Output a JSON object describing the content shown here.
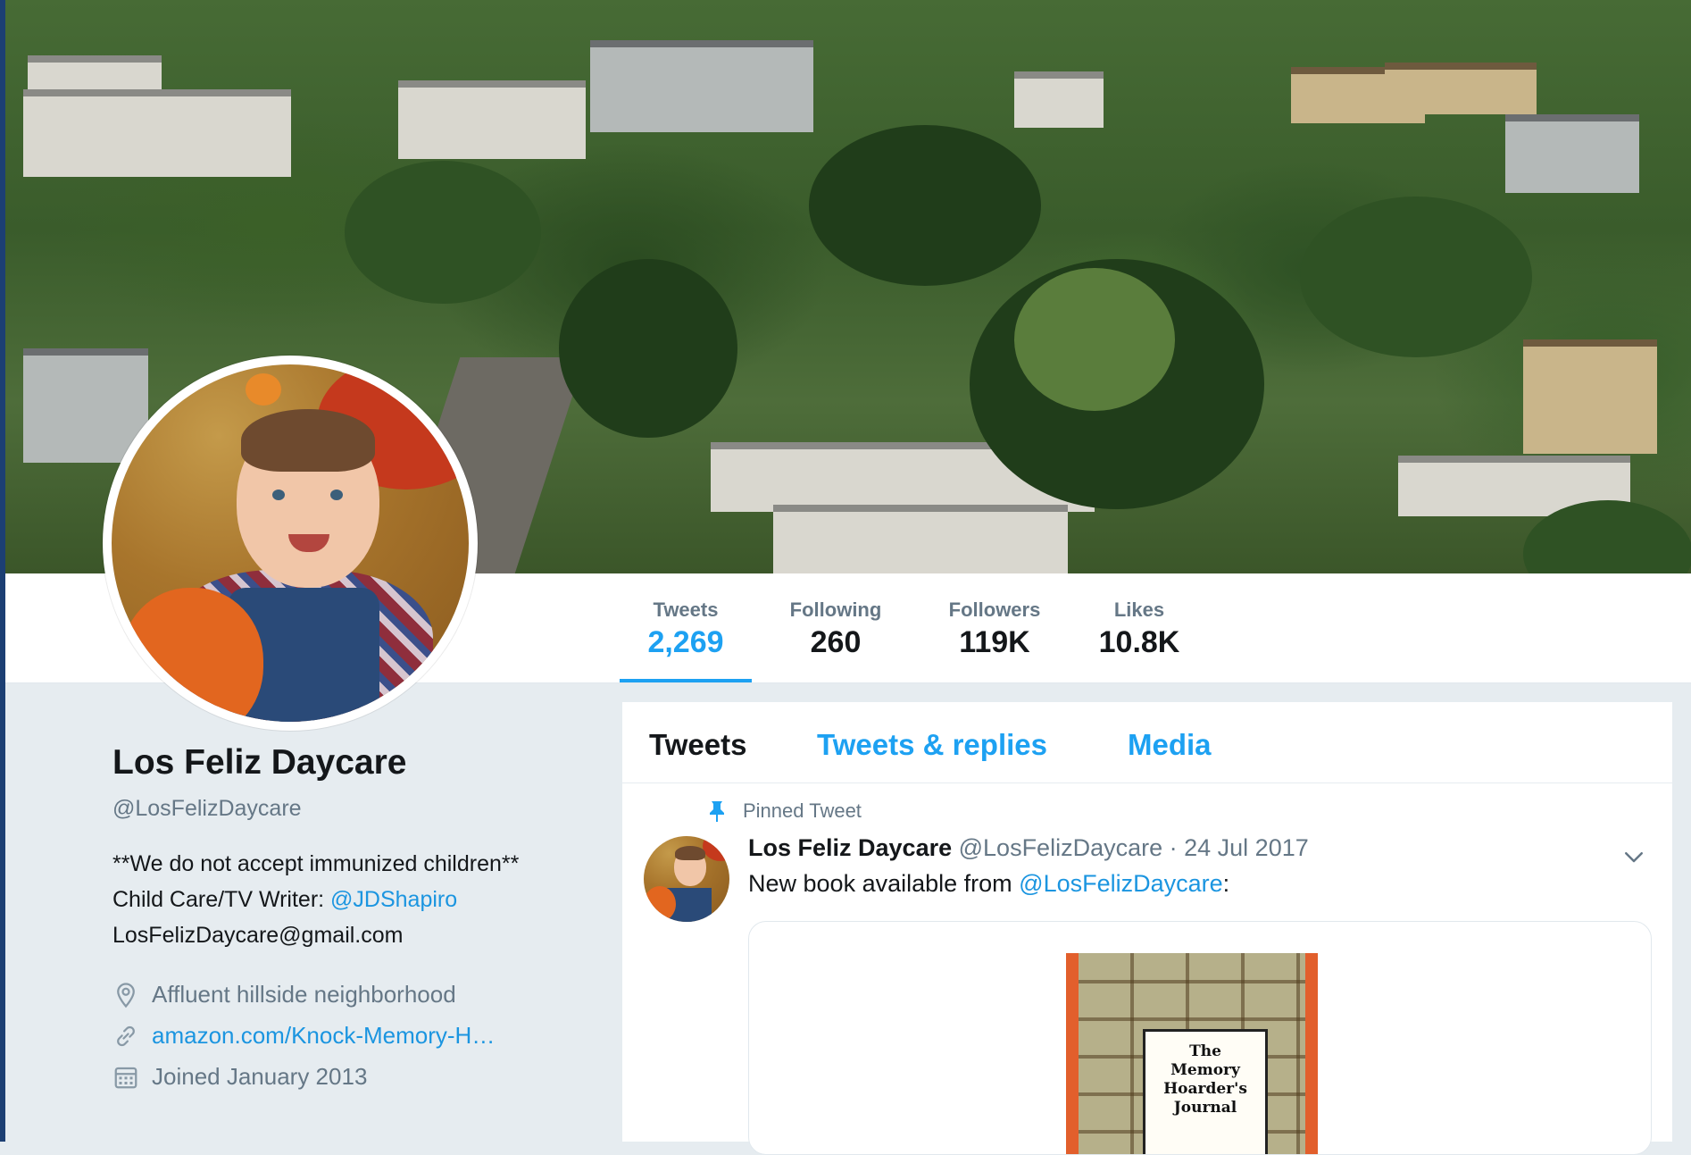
{
  "profile": {
    "name": "Los Feliz Daycare",
    "handle": "@LosFelizDaycare",
    "bio_line1": "**We do not accept immunized children**",
    "bio_line2_prefix": "Child Care/TV Writer: ",
    "bio_line2_link": "@JDShapiro",
    "bio_line3": "LosFelizDaycare@gmail.com",
    "location": "Affluent hillside neighborhood",
    "website": "amazon.com/Knock-Memory-H…",
    "joined": "Joined January 2013"
  },
  "stats": [
    {
      "label": "Tweets",
      "value": "2,269"
    },
    {
      "label": "Following",
      "value": "260"
    },
    {
      "label": "Followers",
      "value": "119K"
    },
    {
      "label": "Likes",
      "value": "10.8K"
    }
  ],
  "timeline": {
    "tabs": [
      "Tweets",
      "Tweets & replies",
      "Media"
    ],
    "pinned_label": "Pinned Tweet",
    "tweet": {
      "name": "Los Feliz Daycare",
      "handle": "@LosFelizDaycare",
      "separator": " · ",
      "date": "24 Jul 2017",
      "text_prefix": "New book available from ",
      "text_link": "@LosFelizDaycare",
      "text_suffix": ":"
    },
    "book_title": [
      "The",
      "Memory",
      "Hoarder's",
      "Journal"
    ]
  },
  "colors": {
    "accent": "#1da1f2",
    "link": "#1b95e0",
    "muted": "#657786",
    "background": "#e6ecf0"
  },
  "icons": {
    "location": "location-pin-icon",
    "website": "link-icon",
    "joined": "calendar-icon",
    "pinned": "pin-icon",
    "caret": "chevron-down-icon"
  }
}
